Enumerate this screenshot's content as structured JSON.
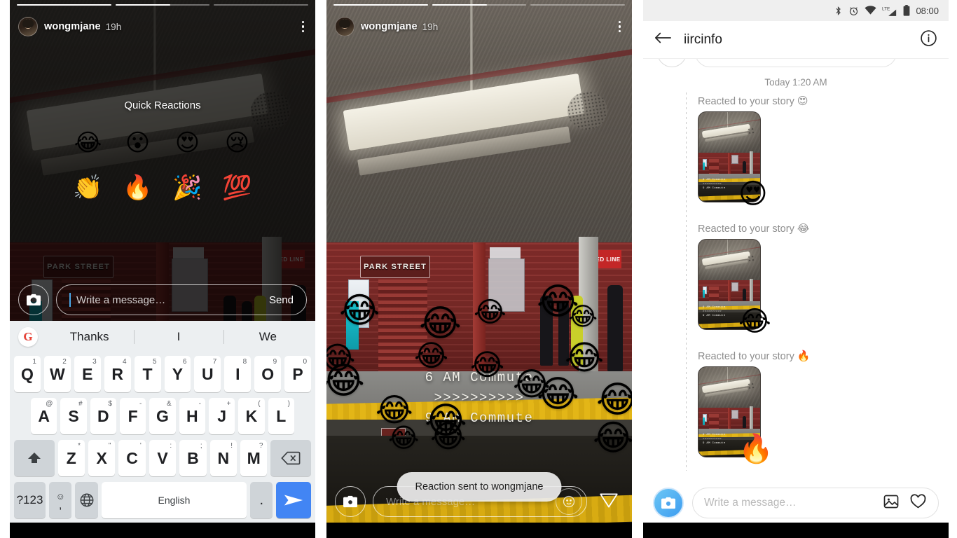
{
  "left_panel": {
    "story": {
      "username": "wongmjane",
      "timestamp": "19h",
      "progress_segments": 3,
      "menu_icon": "kebab-menu-icon",
      "avatar_icon": "user-avatar"
    },
    "quick_reactions": {
      "title": "Quick Reactions",
      "emojis": [
        {
          "name": "face-with-tears-of-joy",
          "glyph": "😂"
        },
        {
          "name": "face-with-open-mouth",
          "glyph": "😮"
        },
        {
          "name": "smiling-face-with-heart-eyes",
          "glyph": "😍"
        },
        {
          "name": "crying-face",
          "glyph": "😢"
        },
        {
          "name": "clapping-hands",
          "glyph": "👏"
        },
        {
          "name": "fire",
          "glyph": "🔥"
        },
        {
          "name": "party-popper",
          "glyph": "🎉"
        },
        {
          "name": "hundred-points",
          "glyph": "💯"
        }
      ]
    },
    "message_bar": {
      "camera_icon": "camera-icon",
      "placeholder": "Write a message…",
      "send_label": "Send"
    },
    "keyboard": {
      "suggestions": [
        "Thanks",
        "I",
        "We"
      ],
      "logo": "G",
      "row1": [
        {
          "key": "Q",
          "alt": "1"
        },
        {
          "key": "W",
          "alt": "2"
        },
        {
          "key": "E",
          "alt": "3"
        },
        {
          "key": "R",
          "alt": "4"
        },
        {
          "key": "T",
          "alt": "5"
        },
        {
          "key": "Y",
          "alt": "6"
        },
        {
          "key": "U",
          "alt": "7"
        },
        {
          "key": "I",
          "alt": "8"
        },
        {
          "key": "O",
          "alt": "9"
        },
        {
          "key": "P",
          "alt": "0"
        }
      ],
      "row2": [
        {
          "key": "A",
          "alt": "@"
        },
        {
          "key": "S",
          "alt": "#"
        },
        {
          "key": "D",
          "alt": "$"
        },
        {
          "key": "F",
          "alt": "-"
        },
        {
          "key": "G",
          "alt": "&"
        },
        {
          "key": "H",
          "alt": "-"
        },
        {
          "key": "J",
          "alt": "+"
        },
        {
          "key": "K",
          "alt": "("
        },
        {
          "key": "L",
          "alt": ")"
        }
      ],
      "row3": [
        {
          "key": "Z",
          "alt": "*"
        },
        {
          "key": "X",
          "alt": "\""
        },
        {
          "key": "C",
          "alt": "'"
        },
        {
          "key": "V",
          "alt": ":"
        },
        {
          "key": "B",
          "alt": ";"
        },
        {
          "key": "N",
          "alt": "!"
        },
        {
          "key": "M",
          "alt": "?"
        }
      ],
      "shift_icon": "shift-arrow-icon",
      "backspace_icon": "backspace-icon",
      "symbols_label": "?123",
      "emoji_key_top": "☺",
      "emoji_key_bottom": ",",
      "globe_icon": "language-globe-icon",
      "space_label": "English",
      "period_label": ".",
      "send_icon": "send-paper-plane-icon"
    }
  },
  "mid_panel": {
    "story": {
      "username": "wongmjane",
      "timestamp": "19h",
      "menu_icon": "kebab-menu-icon"
    },
    "photo_text": {
      "station_sign": "PARK STREET",
      "line_sign": "RED LINE"
    },
    "caption_lines": [
      "6 AM Commute",
      ">>>>>>>>>>",
      "9 AM Commute"
    ],
    "flood_emoji": {
      "name": "face-with-tears-of-joy",
      "glyph": "😂",
      "count": 18
    },
    "toast": "Reaction sent to wongmjane",
    "message_bar": {
      "camera_icon": "camera-icon",
      "placeholder": "Write a message…",
      "emoji_icon": "smiley-icon",
      "send_icon": "direct-send-icon"
    }
  },
  "right_panel": {
    "status_bar": {
      "time": "08:00",
      "icons": [
        "bluetooth-icon",
        "alarm-icon",
        "wifi-icon",
        "lte-signal-icon",
        "battery-icon"
      ],
      "network_label": "LTE"
    },
    "header": {
      "back_icon": "back-arrow-icon",
      "title": "iircinfo",
      "info_icon": "info-icon"
    },
    "day_separator": "Today 1:20 AM",
    "messages": [
      {
        "label": "Reacted to your story",
        "emoji": "😍",
        "emoji_name": "smiling-face-with-heart-eyes",
        "thumb_caption": [
          "6 AM Commute",
          ">>>>>>>>>>",
          "9 AM Commute"
        ]
      },
      {
        "label": "Reacted to your story",
        "emoji": "😂",
        "emoji_name": "face-with-tears-of-joy",
        "thumb_caption": [
          "6 AM Commute",
          ">>>>>>>>>>",
          "9 AM Commute"
        ]
      },
      {
        "label": "Reacted to your story",
        "emoji": "🔥",
        "emoji_name": "fire",
        "thumb_caption": [
          "6 AM Commute",
          ">>>>>>>>>>",
          "9 AM Commute"
        ]
      }
    ],
    "message_bar": {
      "camera_icon": "camera-icon",
      "placeholder": "Write a message…",
      "gallery_icon": "photo-gallery-icon",
      "heart_icon": "heart-icon"
    }
  },
  "colors": {
    "accent_blue": "#4285f4",
    "instagram_blue": "#3d9cf0",
    "keyboard_bg": "#eceff1",
    "muted_text": "#8e8e8e"
  }
}
